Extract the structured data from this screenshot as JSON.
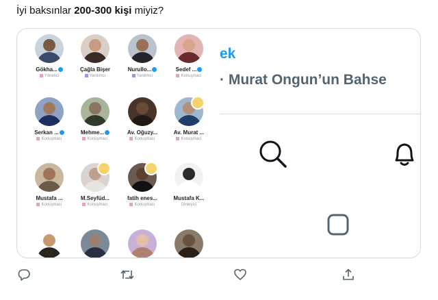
{
  "tweet": {
    "text_prefix": "İyi baksınlar ",
    "text_bold1": "200-300",
    "text_mid": " ",
    "text_bold2": "kişi",
    "text_suffix": " miyiz?"
  },
  "participants": [
    {
      "name": "Gökha...",
      "role": "Yönetici",
      "verified": true,
      "mic": false,
      "skin": "#7a5a45",
      "shirt": "#3b4a6b",
      "bg": "#c9d3dc"
    },
    {
      "name": "Çağla Bişer",
      "role": "Yardımcı",
      "verified": false,
      "mic": false,
      "skin": "#c89a80",
      "shirt": "#3a2b25",
      "bg": "#d9cfc7"
    },
    {
      "name": "Nurullo...",
      "role": "Yardımcı",
      "verified": true,
      "mic": false,
      "skin": "#9b7058",
      "shirt": "#23232b",
      "bg": "#b9c3cd"
    },
    {
      "name": "Sedef ...",
      "role": "Konuşmacı",
      "verified": true,
      "mic": false,
      "skin": "#d8a58c",
      "shirt": "#6b2a30",
      "bg": "#e2b5b5"
    },
    {
      "name": "Serkan ...",
      "role": "Konuşmacı",
      "verified": true,
      "mic": false,
      "skin": "#a07a60",
      "shirt": "#1d2f5c",
      "bg": "#8fa3c4"
    },
    {
      "name": "Mehme...",
      "role": "Konuşmacı",
      "verified": true,
      "mic": false,
      "skin": "#8a7560",
      "shirt": "#2f3a2a",
      "bg": "#a8b59a"
    },
    {
      "name": "Av. Oğuzy...",
      "role": "Konuşmacı",
      "verified": false,
      "mic": false,
      "skin": "#6a4a38",
      "shirt": "#201815",
      "bg": "#4a3428"
    },
    {
      "name": "Av. Murat ...",
      "role": "Konuşmacı",
      "verified": false,
      "mic": true,
      "skin": "#b59078",
      "shirt": "#1f3f6a",
      "bg": "#9fb7cf"
    },
    {
      "name": "Mustafa ...",
      "role": "Konuşmacı",
      "verified": false,
      "mic": false,
      "skin": "#a07458",
      "shirt": "#6a5a48",
      "bg": "#c8b8a0"
    },
    {
      "name": "M.Seyfüd...",
      "role": "Konuşmacı",
      "verified": false,
      "mic": true,
      "skin": "#c0a090",
      "shirt": "#e8e4e0",
      "bg": "#d9d4cf"
    },
    {
      "name": "fatih enes...",
      "role": "Konuşmacı",
      "verified": false,
      "mic": true,
      "skin": "#5a4030",
      "shirt": "#111111",
      "bg": "#6a5a50"
    },
    {
      "name": "Mustafa K...",
      "role": "Dinleyici",
      "verified": false,
      "mic": false,
      "skin": "#2a2a2a",
      "shirt": "#ffffff",
      "bg": "#f2f2f2"
    },
    {
      "name": "",
      "role": "",
      "verified": false,
      "mic": false,
      "skin": "#c89a70",
      "shirt": "#2a2420",
      "bg": "#ffffff"
    },
    {
      "name": "",
      "role": "",
      "verified": false,
      "mic": false,
      "skin": "#9a8070",
      "shirt": "#2a3040",
      "bg": "#7a8a98"
    },
    {
      "name": "",
      "role": "",
      "verified": false,
      "mic": false,
      "skin": "#e0c0a8",
      "shirt": "#b08070",
      "bg": "#c9b0d8"
    },
    {
      "name": "",
      "role": "",
      "verified": false,
      "mic": false,
      "skin": "#6a5040",
      "shirt": "#2a2018",
      "bg": "#8a7a6a"
    }
  ],
  "right_panel": {
    "title_line1": "ek",
    "title_line2": "· Murat Ongun’un Bahse",
    "search_icon": "search-icon",
    "bell_icon": "bell-icon",
    "square_icon": "home-square-icon"
  },
  "actions": {
    "reply_icon": "reply-icon",
    "retweet_icon": "retweet-icon",
    "like_icon": "like-icon",
    "share_icon": "share-icon"
  },
  "colors": {
    "accent": "#1d9bf0",
    "icon_gray": "#536471",
    "border": "#cfd9de"
  }
}
